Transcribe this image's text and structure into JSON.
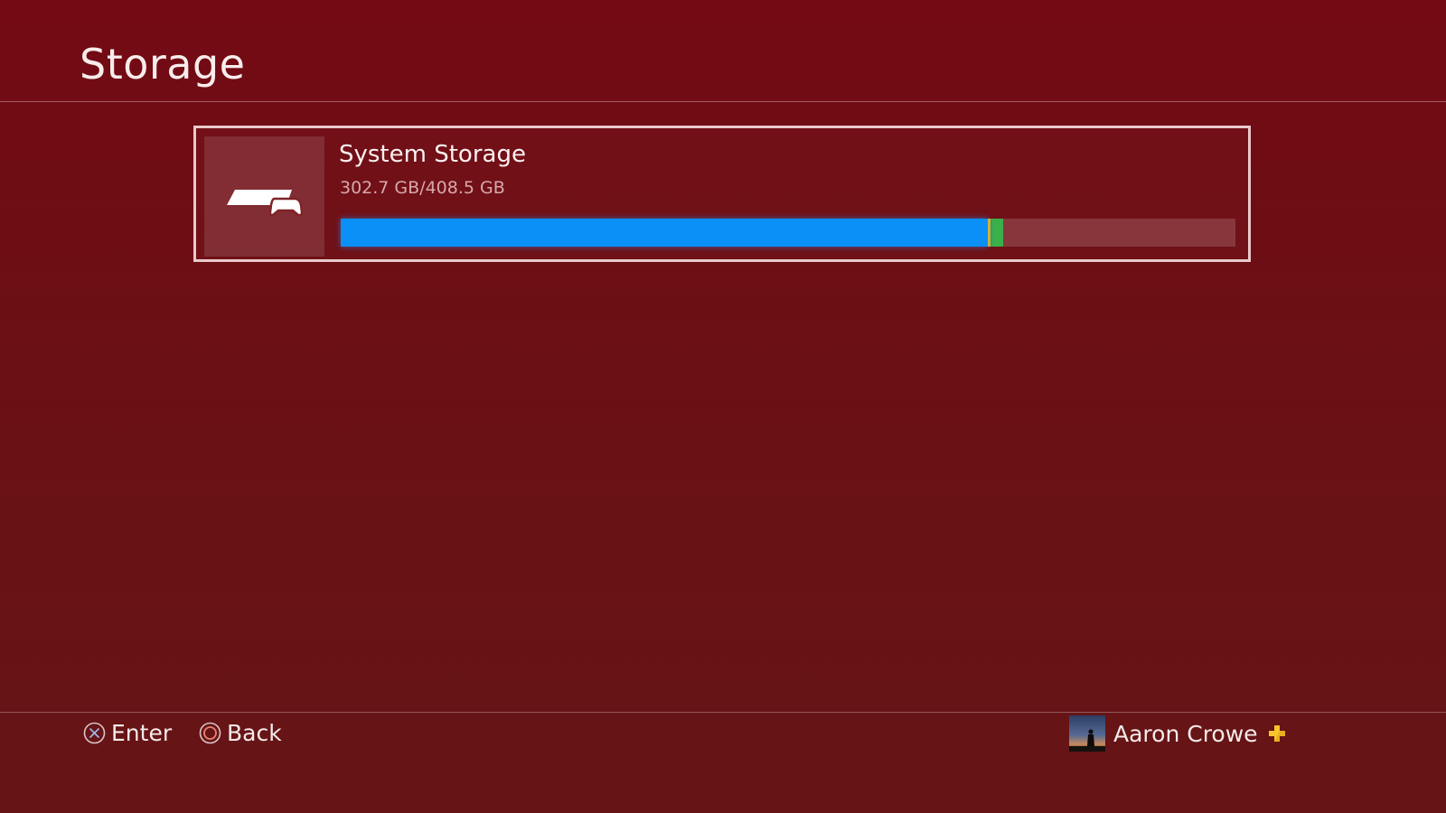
{
  "page": {
    "title": "Storage"
  },
  "storage": {
    "name": "System Storage",
    "usage": "302.7 GB/408.5 GB",
    "icon": "console-controller-icon",
    "used_fraction": 0.741,
    "bar_segments": [
      {
        "name": "applications",
        "fraction": 0.7235,
        "color": "#0a90f6"
      },
      {
        "name": "capture-gallery",
        "fraction": 0.003,
        "color": "#cdb23a"
      },
      {
        "name": "application-saved-data",
        "fraction": 0.002,
        "color": "#3a9a6a"
      },
      {
        "name": "themes",
        "fraction": 0.0125,
        "color": "#39b04a"
      }
    ]
  },
  "footer": {
    "enter_label": "Enter",
    "enter_icon": "cross-button-icon",
    "back_label": "Back",
    "back_icon": "circle-button-icon"
  },
  "user": {
    "name": "Aaron Crowe",
    "plus_icon": "playstation-plus-icon",
    "plus_color": "#f7c62a"
  },
  "colors": {
    "background": "#6b1015",
    "selection_border": "#e9c9cb",
    "usage_text": "#d6a9ac"
  }
}
